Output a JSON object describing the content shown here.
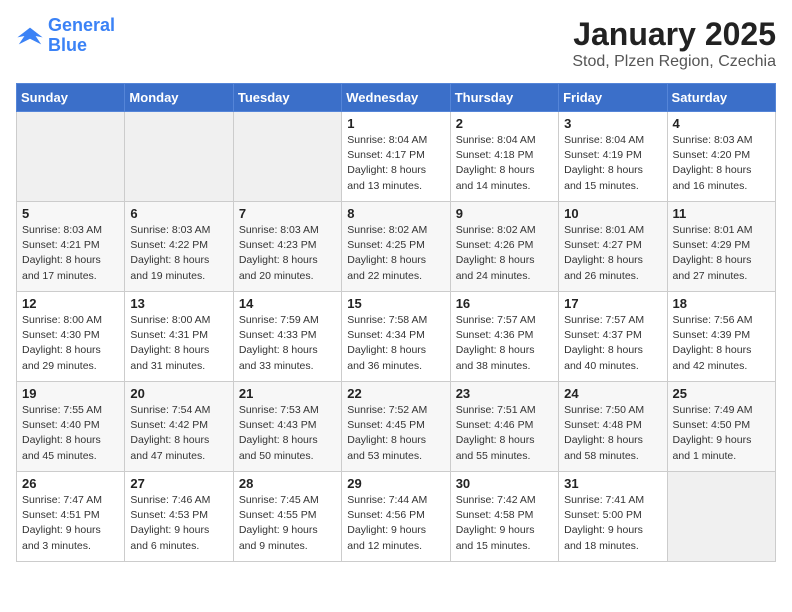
{
  "header": {
    "logo_line1": "General",
    "logo_line2": "Blue",
    "title": "January 2025",
    "subtitle": "Stod, Plzen Region, Czechia"
  },
  "weekdays": [
    "Sunday",
    "Monday",
    "Tuesday",
    "Wednesday",
    "Thursday",
    "Friday",
    "Saturday"
  ],
  "weeks": [
    [
      {
        "day": "",
        "info": ""
      },
      {
        "day": "",
        "info": ""
      },
      {
        "day": "",
        "info": ""
      },
      {
        "day": "1",
        "info": "Sunrise: 8:04 AM\nSunset: 4:17 PM\nDaylight: 8 hours\nand 13 minutes."
      },
      {
        "day": "2",
        "info": "Sunrise: 8:04 AM\nSunset: 4:18 PM\nDaylight: 8 hours\nand 14 minutes."
      },
      {
        "day": "3",
        "info": "Sunrise: 8:04 AM\nSunset: 4:19 PM\nDaylight: 8 hours\nand 15 minutes."
      },
      {
        "day": "4",
        "info": "Sunrise: 8:03 AM\nSunset: 4:20 PM\nDaylight: 8 hours\nand 16 minutes."
      }
    ],
    [
      {
        "day": "5",
        "info": "Sunrise: 8:03 AM\nSunset: 4:21 PM\nDaylight: 8 hours\nand 17 minutes."
      },
      {
        "day": "6",
        "info": "Sunrise: 8:03 AM\nSunset: 4:22 PM\nDaylight: 8 hours\nand 19 minutes."
      },
      {
        "day": "7",
        "info": "Sunrise: 8:03 AM\nSunset: 4:23 PM\nDaylight: 8 hours\nand 20 minutes."
      },
      {
        "day": "8",
        "info": "Sunrise: 8:02 AM\nSunset: 4:25 PM\nDaylight: 8 hours\nand 22 minutes."
      },
      {
        "day": "9",
        "info": "Sunrise: 8:02 AM\nSunset: 4:26 PM\nDaylight: 8 hours\nand 24 minutes."
      },
      {
        "day": "10",
        "info": "Sunrise: 8:01 AM\nSunset: 4:27 PM\nDaylight: 8 hours\nand 26 minutes."
      },
      {
        "day": "11",
        "info": "Sunrise: 8:01 AM\nSunset: 4:29 PM\nDaylight: 8 hours\nand 27 minutes."
      }
    ],
    [
      {
        "day": "12",
        "info": "Sunrise: 8:00 AM\nSunset: 4:30 PM\nDaylight: 8 hours\nand 29 minutes."
      },
      {
        "day": "13",
        "info": "Sunrise: 8:00 AM\nSunset: 4:31 PM\nDaylight: 8 hours\nand 31 minutes."
      },
      {
        "day": "14",
        "info": "Sunrise: 7:59 AM\nSunset: 4:33 PM\nDaylight: 8 hours\nand 33 minutes."
      },
      {
        "day": "15",
        "info": "Sunrise: 7:58 AM\nSunset: 4:34 PM\nDaylight: 8 hours\nand 36 minutes."
      },
      {
        "day": "16",
        "info": "Sunrise: 7:57 AM\nSunset: 4:36 PM\nDaylight: 8 hours\nand 38 minutes."
      },
      {
        "day": "17",
        "info": "Sunrise: 7:57 AM\nSunset: 4:37 PM\nDaylight: 8 hours\nand 40 minutes."
      },
      {
        "day": "18",
        "info": "Sunrise: 7:56 AM\nSunset: 4:39 PM\nDaylight: 8 hours\nand 42 minutes."
      }
    ],
    [
      {
        "day": "19",
        "info": "Sunrise: 7:55 AM\nSunset: 4:40 PM\nDaylight: 8 hours\nand 45 minutes."
      },
      {
        "day": "20",
        "info": "Sunrise: 7:54 AM\nSunset: 4:42 PM\nDaylight: 8 hours\nand 47 minutes."
      },
      {
        "day": "21",
        "info": "Sunrise: 7:53 AM\nSunset: 4:43 PM\nDaylight: 8 hours\nand 50 minutes."
      },
      {
        "day": "22",
        "info": "Sunrise: 7:52 AM\nSunset: 4:45 PM\nDaylight: 8 hours\nand 53 minutes."
      },
      {
        "day": "23",
        "info": "Sunrise: 7:51 AM\nSunset: 4:46 PM\nDaylight: 8 hours\nand 55 minutes."
      },
      {
        "day": "24",
        "info": "Sunrise: 7:50 AM\nSunset: 4:48 PM\nDaylight: 8 hours\nand 58 minutes."
      },
      {
        "day": "25",
        "info": "Sunrise: 7:49 AM\nSunset: 4:50 PM\nDaylight: 9 hours\nand 1 minute."
      }
    ],
    [
      {
        "day": "26",
        "info": "Sunrise: 7:47 AM\nSunset: 4:51 PM\nDaylight: 9 hours\nand 3 minutes."
      },
      {
        "day": "27",
        "info": "Sunrise: 7:46 AM\nSunset: 4:53 PM\nDaylight: 9 hours\nand 6 minutes."
      },
      {
        "day": "28",
        "info": "Sunrise: 7:45 AM\nSunset: 4:55 PM\nDaylight: 9 hours\nand 9 minutes."
      },
      {
        "day": "29",
        "info": "Sunrise: 7:44 AM\nSunset: 4:56 PM\nDaylight: 9 hours\nand 12 minutes."
      },
      {
        "day": "30",
        "info": "Sunrise: 7:42 AM\nSunset: 4:58 PM\nDaylight: 9 hours\nand 15 minutes."
      },
      {
        "day": "31",
        "info": "Sunrise: 7:41 AM\nSunset: 5:00 PM\nDaylight: 9 hours\nand 18 minutes."
      },
      {
        "day": "",
        "info": ""
      }
    ]
  ]
}
